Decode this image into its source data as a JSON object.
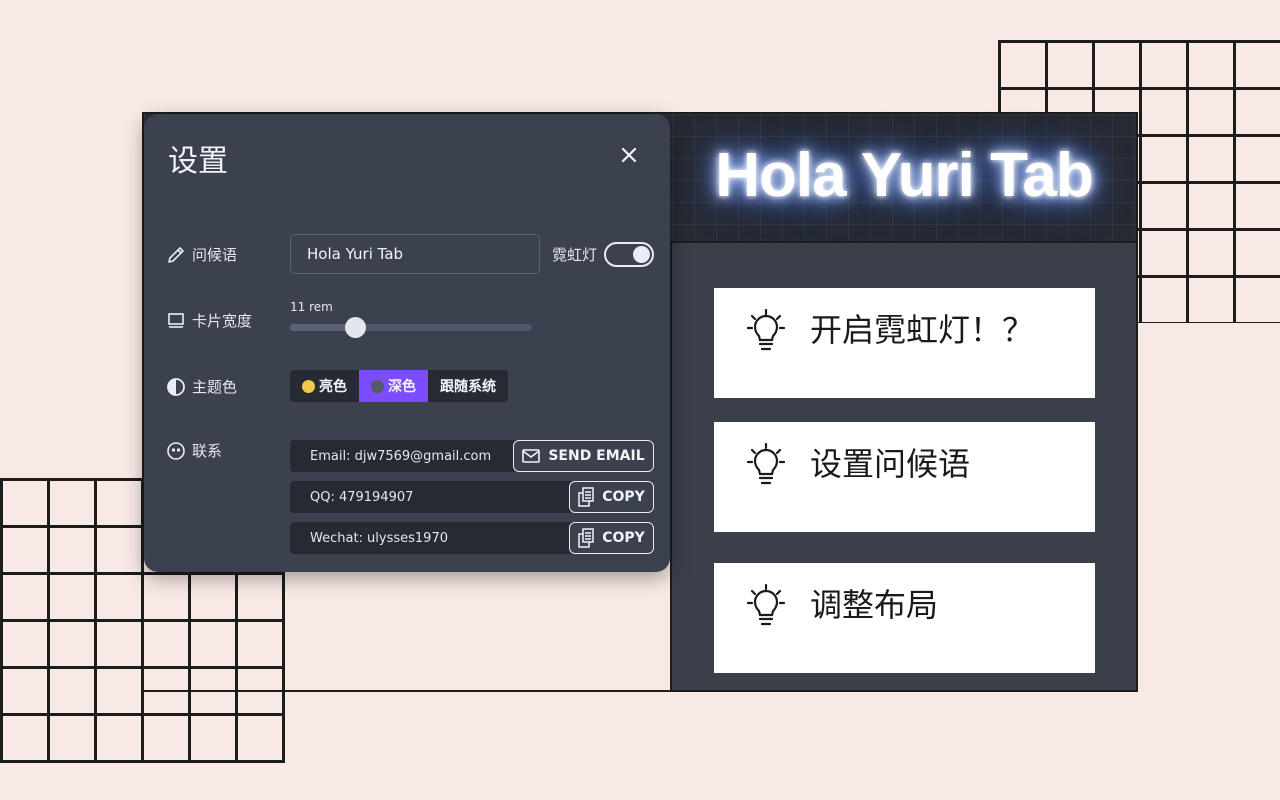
{
  "app": {
    "neon_title": "Hola Yuri Tab",
    "tips": [
      {
        "text": "开启霓虹灯！？"
      },
      {
        "text": "设置问候语"
      },
      {
        "text": "调整布局"
      }
    ]
  },
  "settings": {
    "title": "设置",
    "greeting": {
      "label": "问候语",
      "value": "Hola Yuri Tab",
      "neon_label": "霓虹灯",
      "neon_on": true
    },
    "card_width": {
      "label": "卡片宽度",
      "value_text": "11 rem",
      "fraction": 0.27
    },
    "theme": {
      "label": "主题色",
      "options": [
        {
          "label": "亮色",
          "emoji_color": "#f2c94c"
        },
        {
          "label": "深色",
          "emoji_color": "#555a66",
          "selected": true
        },
        {
          "label": "跟随系统"
        }
      ]
    },
    "contact": {
      "label": "联系",
      "email": {
        "text": "Email: djw7569@gmail.com",
        "button": "SEND EMAIL"
      },
      "qq": {
        "text": "QQ: 479194907",
        "button": "COPY"
      },
      "wechat": {
        "text": "Wechat: ulysses1970",
        "button": "COPY"
      }
    }
  },
  "colors": {
    "accent": "#7c4dff",
    "dialog_bg": "#3b414f",
    "field_bg": "#262a33"
  }
}
